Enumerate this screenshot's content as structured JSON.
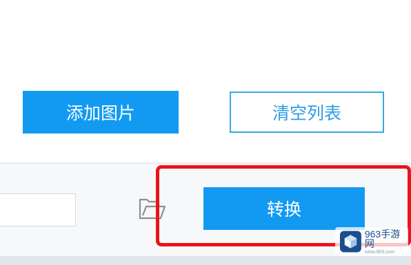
{
  "toolbar": {
    "add_label": "添加图片",
    "clear_label": "清空列表"
  },
  "output": {
    "path_value": "",
    "folder_icon": "folder-open-icon",
    "convert_label": "转换"
  },
  "watermark": {
    "title": "963手游网",
    "url": "www.963.com"
  },
  "colors": {
    "accent": "#129af2",
    "outline": "#39a6e6",
    "highlight": "#e9141c",
    "bottom_panel": "#f6f8fa"
  }
}
